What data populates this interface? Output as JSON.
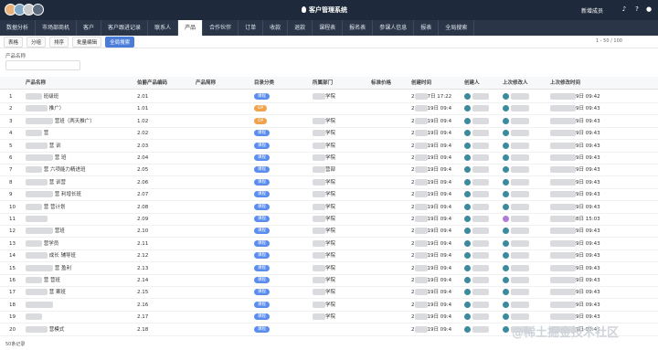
{
  "app": {
    "title": "客户管理系统",
    "new_member": "新增成员"
  },
  "colors": {
    "titlebar": "#1e2a3b",
    "tabbar": "#2a3647",
    "accent": "#4a7dd9",
    "badge_blue": "#5b8def",
    "badge_orange": "#f0a24c"
  },
  "tabs": [
    "数据分析",
    "市场部商机",
    "客户",
    "客户跟进记录",
    "联系人",
    "产品",
    "合作伙伴",
    "订单",
    "收款",
    "退款",
    "课程表",
    "报名表",
    "参课人信息",
    "报表",
    "全局搜索"
  ],
  "active_tab": "产品",
  "toolbar": {
    "view": "表格",
    "group": "分组",
    "sort": "排序",
    "bulk": "批量编辑",
    "global_search": "全局搜索"
  },
  "search": {
    "label": "产品名称",
    "value": ""
  },
  "pager": "1 - 50 / 100",
  "columns": [
    "产品名称",
    "伯爵产品编码",
    "产品简称",
    "目录分类",
    "所属部门",
    "标准价格",
    "创建时间",
    "创建人",
    "上次修改人",
    "上次修改时间"
  ],
  "rows": [
    {
      "n": "1",
      "name_suffix": "班级班",
      "code": "2.01",
      "cat": "课程",
      "dept_suffix": "学院",
      "created_mid": "7日 17:22",
      "modified_suffix": "9日 09:42"
    },
    {
      "n": "2",
      "name_suffix": "推广）",
      "code": "1.01",
      "cat": "OP",
      "dept_suffix": "",
      "created_mid": "19日 09:4",
      "modified_suffix": "9日 09:43"
    },
    {
      "n": "3",
      "name_suffix": "营班（两天推广）",
      "code": "1.02",
      "cat": "OP",
      "dept_suffix": "学院",
      "created_mid": "19日 09:4",
      "modified_suffix": "9日 09:43"
    },
    {
      "n": "4",
      "name_suffix": "营",
      "code": "2.02",
      "cat": "课程",
      "dept_suffix": "学院",
      "created_mid": "19日 09:4",
      "modified_suffix": "9日 09:43"
    },
    {
      "n": "5",
      "name_suffix": "营 训",
      "code": "2.03",
      "cat": "课程",
      "dept_suffix": "学院",
      "created_mid": "19日 09:4",
      "modified_suffix": "9日 09:43"
    },
    {
      "n": "6",
      "name_suffix": "营 班",
      "code": "2.04",
      "cat": "课程",
      "dept_suffix": "学院",
      "created_mid": "19日 09:4",
      "modified_suffix": "9日 09:43"
    },
    {
      "n": "7",
      "name_suffix": "营 六项能力精进班",
      "code": "2.05",
      "cat": "课程",
      "dept_suffix": "营部",
      "created_mid": "19日 09:4",
      "modified_suffix": "9日 09:43"
    },
    {
      "n": "8",
      "name_suffix": "营 训营",
      "code": "2.06",
      "cat": "课程",
      "dept_suffix": "学院",
      "created_mid": "19日 09:4",
      "modified_suffix": "9日 09:43"
    },
    {
      "n": "9",
      "name_suffix": "营 利增长班",
      "code": "2.07",
      "cat": "课程",
      "dept_suffix": "学院",
      "created_mid": "19日 09:4",
      "modified_suffix": "9日 09:43"
    },
    {
      "n": "10",
      "name_suffix": "营 营计划",
      "code": "2.08",
      "cat": "课程",
      "dept_suffix": "学院",
      "created_mid": "19日 09:4",
      "modified_suffix": "9日 09:43"
    },
    {
      "n": "11",
      "name_suffix": "",
      "code": "2.09",
      "cat": "课程",
      "dept_suffix": "学院",
      "created_mid": "19日 09:4",
      "modified_suffix": "8日 15:03"
    },
    {
      "n": "12",
      "name_suffix": "营班",
      "code": "2.10",
      "cat": "课程",
      "dept_suffix": "学院",
      "created_mid": "19日 09:4",
      "modified_suffix": "9日 09:43"
    },
    {
      "n": "13",
      "name_suffix": "营学员",
      "code": "2.11",
      "cat": "课程",
      "dept_suffix": "学院",
      "created_mid": "19日 09:4",
      "modified_suffix": "9日 09:43"
    },
    {
      "n": "14",
      "name_suffix": "成长 辅导班",
      "code": "2.12",
      "cat": "课程",
      "dept_suffix": "学院",
      "created_mid": "19日 09:4",
      "modified_suffix": "9日 09:43"
    },
    {
      "n": "15",
      "name_suffix": "营 盈利",
      "code": "2.13",
      "cat": "课程",
      "dept_suffix": "学院",
      "created_mid": "19日 09:4",
      "modified_suffix": "9日 09:43"
    },
    {
      "n": "16",
      "name_suffix": "营 营班",
      "code": "2.14",
      "cat": "课程",
      "dept_suffix": "学院",
      "created_mid": "19日 09:4",
      "modified_suffix": "9日 09:43"
    },
    {
      "n": "17",
      "name_suffix": "营 案班",
      "code": "2.15",
      "cat": "课程",
      "dept_suffix": "学院",
      "created_mid": "19日 09:4",
      "modified_suffix": "9日 09:43"
    },
    {
      "n": "18",
      "name_suffix": "",
      "code": "2.16",
      "cat": "课程",
      "dept_suffix": "学院",
      "created_mid": "19日 09:4",
      "modified_suffix": "9日 09:43"
    },
    {
      "n": "19",
      "name_suffix": "",
      "code": "2.17",
      "cat": "课程",
      "dept_suffix": "学院",
      "created_mid": "19日 09:4",
      "modified_suffix": "9日 09:43"
    },
    {
      "n": "20",
      "name_suffix": "营模式",
      "code": "2.18",
      "cat": "课程",
      "dept_suffix": "",
      "created_mid": "19日 09:4",
      "modified_suffix": "9日 09:43"
    }
  ],
  "footer": "50条记录",
  "watermark": "@稀土掘金技术社区"
}
